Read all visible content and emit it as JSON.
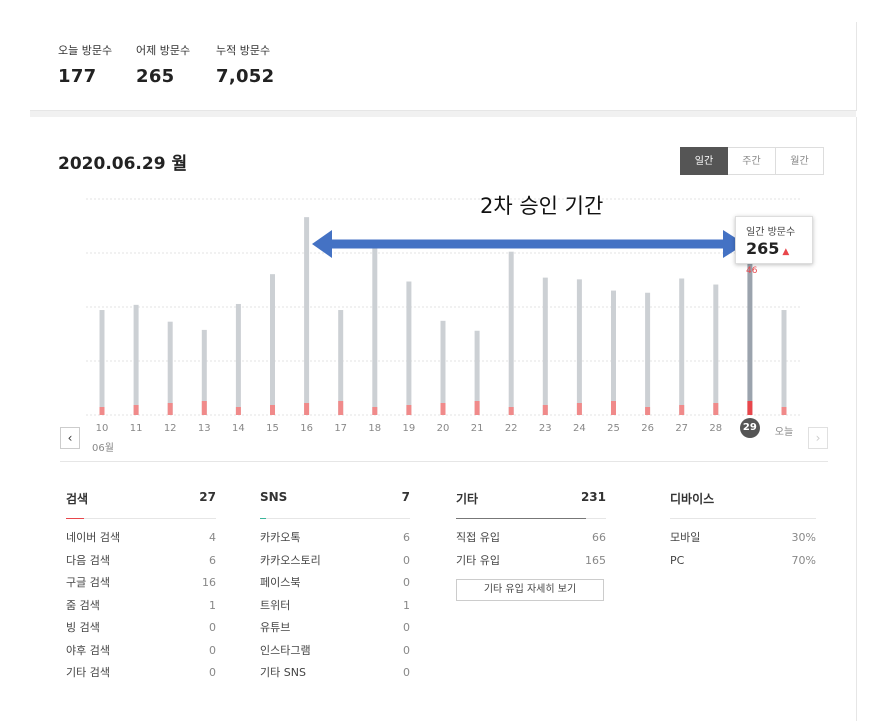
{
  "stats": [
    {
      "label": "오늘 방문수",
      "value": "177"
    },
    {
      "label": "어제 방문수",
      "value": "265"
    },
    {
      "label": "누적 방문수",
      "value": "7,052"
    }
  ],
  "date_title": "2020.06.29 월",
  "tabs": [
    {
      "label": "일간",
      "active": true
    },
    {
      "label": "주간",
      "active": false
    },
    {
      "label": "월간",
      "active": false
    }
  ],
  "annotation": "2차 승인 기간",
  "tooltip": {
    "label": "일간 방문수",
    "value": "265",
    "delta": "▲ 46"
  },
  "chart_data": {
    "type": "bar",
    "categories": [
      "10",
      "11",
      "12",
      "13",
      "14",
      "15",
      "16",
      "17",
      "18",
      "19",
      "20",
      "21",
      "22",
      "23",
      "24",
      "25",
      "26",
      "27",
      "28",
      "29",
      "오늘"
    ],
    "month_label": "06월",
    "selected": "29",
    "values": [
      243,
      255,
      216,
      197,
      257,
      326,
      458,
      243,
      388,
      309,
      218,
      195,
      378,
      318,
      314,
      288,
      283,
      316,
      302,
      373,
      243
    ],
    "ylim": [
      0,
      500
    ],
    "grid": true,
    "colors": {
      "bar": "#ccd0d4",
      "selected": "#9ba3ad",
      "search": "#f08a8a",
      "sns": "#a8dcc8",
      "highlight": "#e8464b"
    }
  },
  "categories": [
    {
      "name": "검색",
      "total": "27",
      "color": "#e8464b",
      "items": [
        {
          "label": "네이버 검색",
          "value": "4"
        },
        {
          "label": "다음 검색",
          "value": "6"
        },
        {
          "label": "구글 검색",
          "value": "16"
        },
        {
          "label": "줌 검색",
          "value": "1"
        },
        {
          "label": "빙 검색",
          "value": "0"
        },
        {
          "label": "야후 검색",
          "value": "0"
        },
        {
          "label": "기타 검색",
          "value": "0"
        }
      ]
    },
    {
      "name": "SNS",
      "total": "7",
      "color": "#3bb59a",
      "items": [
        {
          "label": "카카오톡",
          "value": "6"
        },
        {
          "label": "카카오스토리",
          "value": "0"
        },
        {
          "label": "페이스북",
          "value": "0"
        },
        {
          "label": "트위터",
          "value": "1"
        },
        {
          "label": "유튜브",
          "value": "0"
        },
        {
          "label": "인스타그램",
          "value": "0"
        },
        {
          "label": "기타 SNS",
          "value": "0"
        }
      ]
    },
    {
      "name": "기타",
      "total": "231",
      "color": "#777777",
      "more": "기타 유입 자세히 보기",
      "items": [
        {
          "label": "직접 유입",
          "value": "66"
        },
        {
          "label": "기타 유입",
          "value": "165"
        }
      ]
    },
    {
      "name": "디바이스",
      "total": "",
      "color": "#e6e6e6",
      "items": [
        {
          "label": "모바일",
          "value": "30%"
        },
        {
          "label": "PC",
          "value": "70%"
        }
      ]
    }
  ]
}
